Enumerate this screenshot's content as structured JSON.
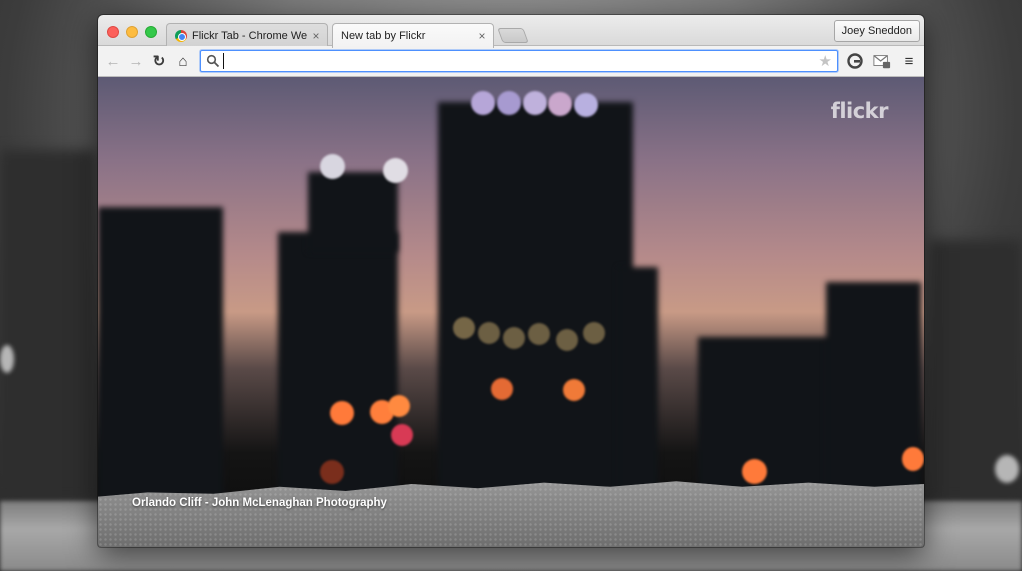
{
  "window": {
    "tabs": [
      {
        "title": "Flickr Tab - Chrome Web S",
        "active": false,
        "favicon": "chrome-web-store-icon"
      },
      {
        "title": "New tab by Flickr",
        "active": true,
        "favicon": null
      }
    ],
    "close_glyph": "×",
    "profile_name": "Joey Sneddon"
  },
  "toolbar": {
    "back_glyph": "←",
    "forward_glyph": "→",
    "reload_glyph": "↻",
    "home_glyph": "⌂",
    "omnibox_value": "",
    "star_glyph": "★",
    "menu_glyph": "≡"
  },
  "page": {
    "logo": "flickr",
    "photo_credit": "Orlando Cliff - John McLenaghan Photography"
  },
  "colors": {
    "accent_focus": "#4d90fe",
    "close": "#fc605b",
    "minimize": "#fdbc40",
    "maximize": "#34c84a"
  }
}
